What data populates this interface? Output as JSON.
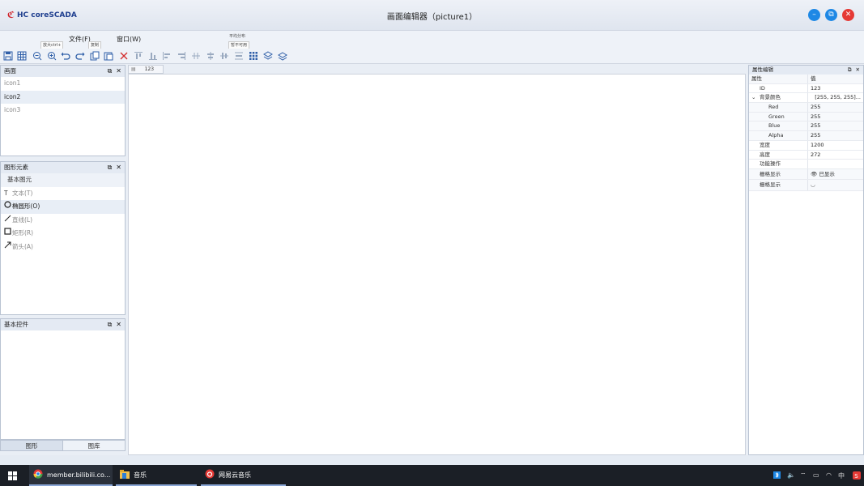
{
  "app": {
    "logo_text": "HC coreSCADA",
    "window_title": "画面编辑器（picture1）"
  },
  "menu": {
    "file": "文件(F)",
    "window": "窗口(W)",
    "tooltips": [
      "放大ctrl+",
      "复制",
      "平均分布",
      "暂不可用"
    ]
  },
  "toolbar_icons": [
    "save-icon",
    "grid-icon",
    "zoom-out-icon",
    "zoom-in-icon",
    "undo-icon",
    "redo-icon",
    "copy-icon",
    "paste-icon",
    "delete-icon",
    "align-top-icon",
    "align-bottom-icon",
    "align-left-icon",
    "align-right-icon",
    "distribute-h-icon",
    "center-h-icon",
    "center-v-icon",
    "distribute-v-icon",
    "grid-dots-icon",
    "layer-up-icon",
    "layer-down-icon"
  ],
  "picture_panel": {
    "title": "画面",
    "items": [
      "icon1",
      "icon2",
      "icon3"
    ],
    "selected_index": 1
  },
  "elements_panel": {
    "title": "图形元素",
    "group": "基本图元",
    "items": [
      {
        "icon": "text-icon",
        "label": "文本(T)"
      },
      {
        "icon": "ellipse-icon",
        "label": "椭圆形(O)"
      },
      {
        "icon": "line-icon",
        "label": "直线(L)"
      },
      {
        "icon": "rect-icon",
        "label": "矩形(R)"
      },
      {
        "icon": "arrow-icon",
        "label": "箭头(A)"
      }
    ],
    "selected_index": 1
  },
  "controls_panel": {
    "title": "基本控件"
  },
  "bottom_tabs": [
    "图形",
    "图库"
  ],
  "doc_tab": {
    "label": "123"
  },
  "property_panel": {
    "title": "属性编辑",
    "header": {
      "k": "属性",
      "v": "值"
    },
    "rows": [
      {
        "k": "ID",
        "v": "123",
        "indent": 1
      },
      {
        "k": "背景颜色",
        "v": "[255, 255, 255]...",
        "indent": 1,
        "expander": "v"
      },
      {
        "k": "Red",
        "v": "255",
        "indent": 2
      },
      {
        "k": "Green",
        "v": "255",
        "indent": 2
      },
      {
        "k": "Blue",
        "v": "255",
        "indent": 2
      },
      {
        "k": "Alpha",
        "v": "255",
        "indent": 2
      },
      {
        "k": "宽度",
        "v": "1200",
        "indent": 1
      },
      {
        "k": "高度",
        "v": "272",
        "indent": 1
      },
      {
        "k": "功能操作",
        "v": "",
        "indent": 1
      },
      {
        "k": "栅格显示",
        "v": "已显示",
        "indent": 1,
        "icon": "eye-open-icon"
      },
      {
        "k": "栅格显示",
        "v": "",
        "indent": 1,
        "icon": "eye-closed-icon"
      }
    ]
  },
  "taskbar": {
    "items": [
      {
        "icon": "chrome-icon",
        "label": "member.bilibili.co..."
      },
      {
        "icon": "folder-icon",
        "label": "音乐"
      },
      {
        "icon": "netease-music-icon",
        "label": "网易云音乐"
      }
    ],
    "tray_lang": "中"
  },
  "colors": {
    "window_btn_min": "#1e88e5",
    "window_btn_restore": "#1e88e5",
    "window_btn_close": "#e53935",
    "brand": "#1f3f8f",
    "icon_blue": "#2f5fa8"
  }
}
